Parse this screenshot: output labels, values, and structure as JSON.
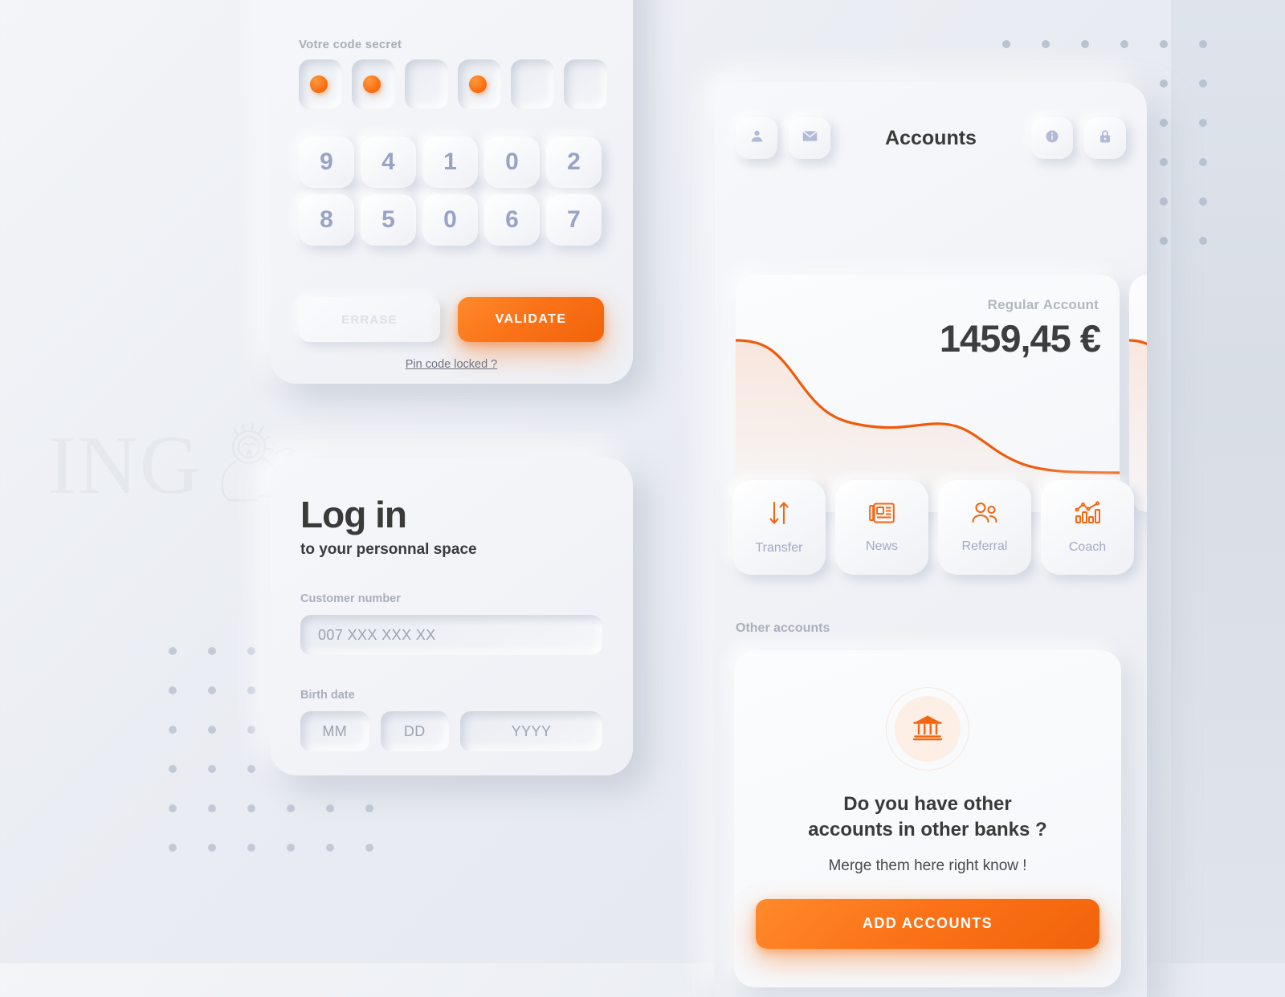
{
  "brand": {
    "accent": "#f96a0d",
    "name": "ING",
    "watermark_icon": "lion-icon"
  },
  "background": {
    "color": "#e6e9ef",
    "right_panel_color": "#dce1ea"
  },
  "pin_screen": {
    "label": "Votre code secret",
    "slot_count": 6,
    "filled_slots": [
      true,
      true,
      false,
      true,
      false,
      false
    ],
    "keypad_rows": [
      [
        "9",
        "4",
        "1",
        "0",
        "2"
      ],
      [
        "8",
        "5",
        "0",
        "6",
        "7"
      ]
    ],
    "erase_label": "ERRASE",
    "validate_label": "VALIDATE",
    "locked_link": "Pin code locked ?"
  },
  "login": {
    "title": "Log in",
    "subtitle": "to your personnal space",
    "customer_label": "Customer number",
    "customer_placeholder": "007 XXX XXX XX",
    "birth_label": "Birth date",
    "birth_mm": "MM",
    "birth_dd": "DD",
    "birth_yyyy": "YYYY"
  },
  "accounts": {
    "title": "Accounts",
    "header_icons": [
      {
        "name": "user-icon",
        "glyph": "person"
      },
      {
        "name": "mail-icon",
        "glyph": "envelope"
      },
      {
        "name": "info-icon",
        "glyph": "info"
      },
      {
        "name": "lock-icon",
        "glyph": "lock"
      }
    ],
    "balance_card": {
      "label": "Regular Account",
      "amount": "1459,45 €"
    },
    "quick_actions": [
      {
        "label": "Transfer",
        "icon": "transfer-arrows-icon"
      },
      {
        "label": "News",
        "icon": "newspaper-icon"
      },
      {
        "label": "Referral",
        "icon": "people-icon"
      },
      {
        "label": "Coach",
        "icon": "bar-chart-icon"
      }
    ],
    "other_accounts": {
      "section_title": "Other accounts",
      "icon": "bank-icon",
      "headline_line1": "Do you have other",
      "headline_line2": "accounts in other banks ?",
      "subtext": "Merge them here right know !",
      "cta_label": "ADD ACCOUNTS"
    }
  },
  "chart_data": {
    "type": "line",
    "title": "Regular Account balance trend",
    "series": [
      {
        "name": "Regular Account",
        "values": [
          100,
          98,
          88,
          72,
          58,
          50,
          48,
          47,
          45,
          36,
          26,
          20,
          18,
          18
        ]
      }
    ],
    "x": [
      0,
      1,
      2,
      3,
      4,
      5,
      6,
      7,
      8,
      9,
      10,
      11,
      12,
      13
    ],
    "line_color": "#f05a0a",
    "fill": true,
    "grid": false,
    "axis_visible": false,
    "ylim": [
      0,
      110
    ],
    "xlabel": "",
    "ylabel": ""
  }
}
